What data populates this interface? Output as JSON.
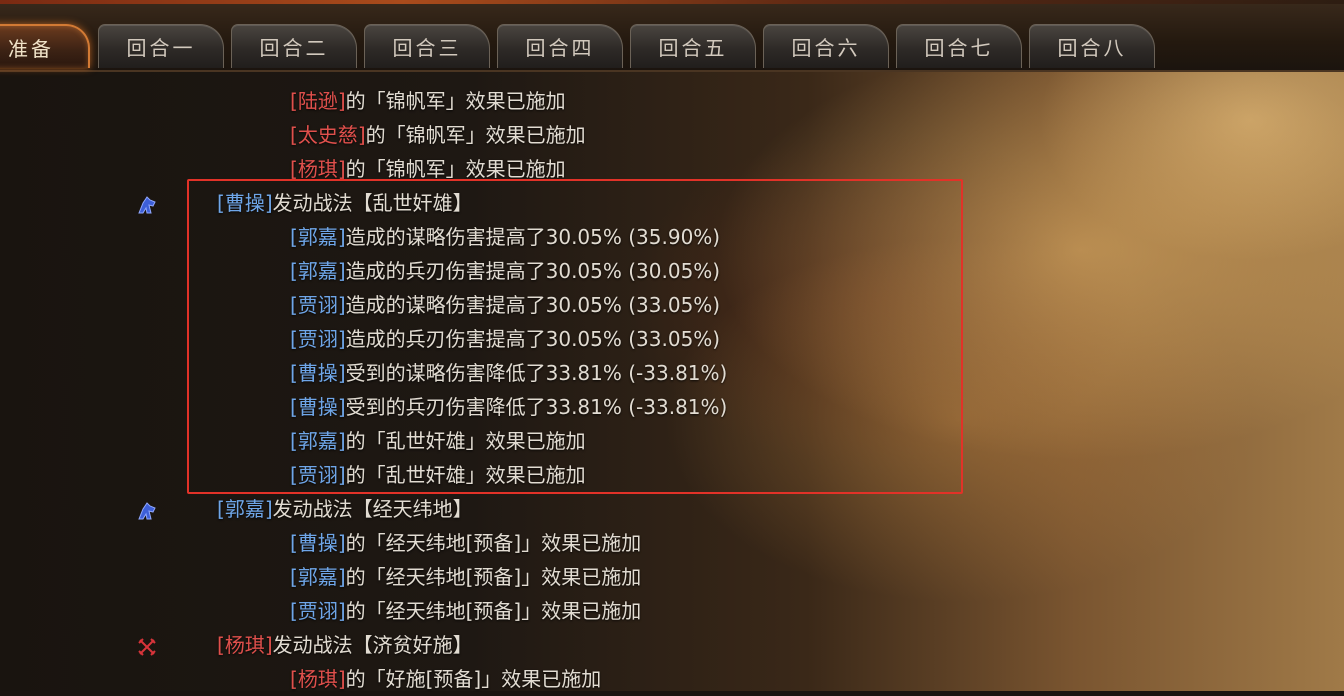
{
  "tabs": [
    "准备",
    "回合一",
    "回合二",
    "回合三",
    "回合四",
    "回合五",
    "回合六",
    "回合七",
    "回合八"
  ],
  "lines": [
    {
      "general": "陆逊",
      "text": "的「锦帆军」效果已施加"
    },
    {
      "general": "太史慈",
      "text": "的「锦帆军」效果已施加"
    },
    {
      "general": "杨琪",
      "text": "的「锦帆军」效果已施加"
    },
    {
      "general": "曹操",
      "text": "发动战法【乱世奸雄】"
    },
    {
      "general": "郭嘉",
      "text": "造成的谋略伤害提高了30.05% (35.90%)"
    },
    {
      "general": "郭嘉",
      "text": "造成的兵刃伤害提高了30.05% (30.05%)"
    },
    {
      "general": "贾诩",
      "text": "造成的谋略伤害提高了30.05% (33.05%)"
    },
    {
      "general": "贾诩",
      "text": "造成的兵刃伤害提高了30.05% (33.05%)"
    },
    {
      "general": "曹操",
      "text": "受到的谋略伤害降低了33.81% (-33.81%)"
    },
    {
      "general": "曹操",
      "text": "受到的兵刃伤害降低了33.81% (-33.81%)"
    },
    {
      "general": "郭嘉",
      "text": "的「乱世奸雄」效果已施加"
    },
    {
      "general": "贾诩",
      "text": "的「乱世奸雄」效果已施加"
    },
    {
      "general": "郭嘉",
      "text": "发动战法【经天纬地】"
    },
    {
      "general": "曹操",
      "text": "的「经天纬地[预备]」效果已施加"
    },
    {
      "general": "郭嘉",
      "text": "的「经天纬地[预备]」效果已施加"
    },
    {
      "general": "贾诩",
      "text": "的「经天纬地[预备]」效果已施加"
    },
    {
      "general": "杨琪",
      "text": "发动战法【济贫好施】"
    },
    {
      "general": "杨琪",
      "text": "的「好施[预备]」效果已施加"
    }
  ],
  "icons": [
    "blue-horse-icon",
    "blue-horse-icon",
    "red-crossed-swords-icon"
  ],
  "colors": {
    "ally_name": "#6fa6e8",
    "enemy_name": "#e0504c",
    "highlight_border": "#e23228",
    "active_tab_border": "#d27a34"
  }
}
